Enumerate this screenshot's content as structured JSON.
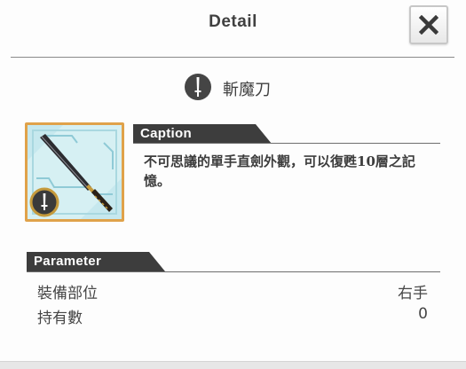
{
  "header": {
    "title": "Detail",
    "close_icon": "close-icon"
  },
  "item": {
    "name": "斬魔刀",
    "type_icon": "sword-type-icon",
    "thumbnail_icon": "katana-icon"
  },
  "caption": {
    "label": "Caption",
    "text": "不可思議的單手直劍外觀，可以復甦10層之記憶。"
  },
  "parameter": {
    "label": "Parameter",
    "rows": [
      {
        "label": "裝備部位",
        "value": "右手"
      },
      {
        "label": "持有數",
        "value": "0"
      }
    ]
  },
  "colors": {
    "tab_background": "#3d3d3d",
    "thumb_border": "#e0a24a",
    "thumb_background": "#d6f0f3",
    "type_icon": "#454545"
  }
}
